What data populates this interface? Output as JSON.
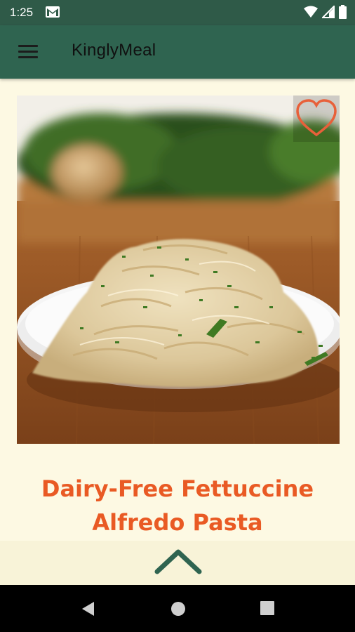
{
  "status": {
    "time": "1:25"
  },
  "appbar": {
    "title": "KinglyMeal"
  },
  "recipe": {
    "title_line1": "Dairy-Free Fettuccine",
    "title_line2": "Alfredo Pasta"
  },
  "colors": {
    "appbar": "#2f6450",
    "statusbar": "#2f5a48",
    "accent": "#e95a24",
    "background": "#fdf9e3",
    "chevron": "#2f6450"
  },
  "icons": {
    "menu": "hamburger-menu-icon",
    "favorite": "heart-outline-icon",
    "expand": "chevron-up-icon",
    "notification": "gmail-icon"
  }
}
